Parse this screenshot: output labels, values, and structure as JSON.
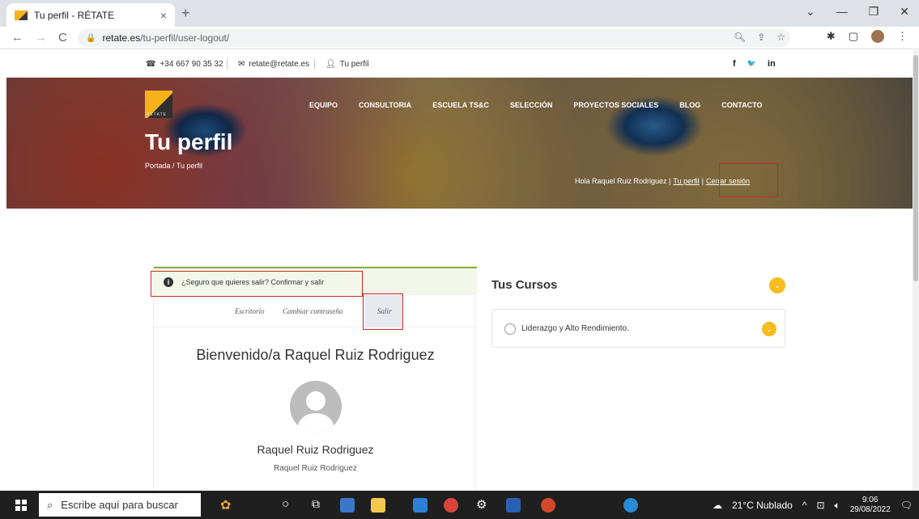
{
  "browser": {
    "tab_title": "Tu perfil - RÉTATE",
    "tab_close": "×",
    "new_tab": "+",
    "url_host": "retate.es",
    "url_path": "/tu-perfil/user-logout/",
    "window_controls": [
      "⌄",
      "—",
      "❐",
      "✕"
    ]
  },
  "topbar": {
    "phone": "+34 667 90 35 32",
    "email": "retate@retate.es",
    "profile": "Tu perfil",
    "social": [
      "f",
      "🐦",
      "in"
    ]
  },
  "hero": {
    "logo_text": "RÉTATE",
    "nav": [
      "EQUIPO",
      "CONSULTORIA",
      "ESCUELA TS&C",
      "SELECCIÓN",
      "PROYECTOS SOCIALES",
      "BLOG",
      "CONTACTO"
    ],
    "title": "Tu perfil",
    "breadcrumb": "Portada / Tu perfil",
    "greeting": "Hola Raquel Ruiz Rodriguez |",
    "greeting_profile": "Tu perfil",
    "greeting_sep": "|",
    "logout": "Cerrar sesión"
  },
  "account": {
    "notice": "¿Seguro que quieres salir? Confirmar y salir",
    "tabs": [
      "Escritorio",
      "Cambiar contraseña",
      "Salir"
    ],
    "welcome": "Bienvenido/a Raquel Ruiz Rodriguez",
    "display_name": "Raquel Ruiz Rodriguez",
    "username": "Raquel Ruiz Rodriguez"
  },
  "courses": {
    "title": "Tus Cursos",
    "items": [
      "Liderazgo y Alto Rendimiento."
    ]
  },
  "taskbar": {
    "search_placeholder": "Escribe aquí para buscar",
    "weather": "21°C Nublado",
    "time": "9:06",
    "date": "29/08/2022"
  },
  "colors": {
    "accent_gold": "#f5bd1f",
    "notice_green": "#8bb13a",
    "highlight_red": "#c62828"
  }
}
